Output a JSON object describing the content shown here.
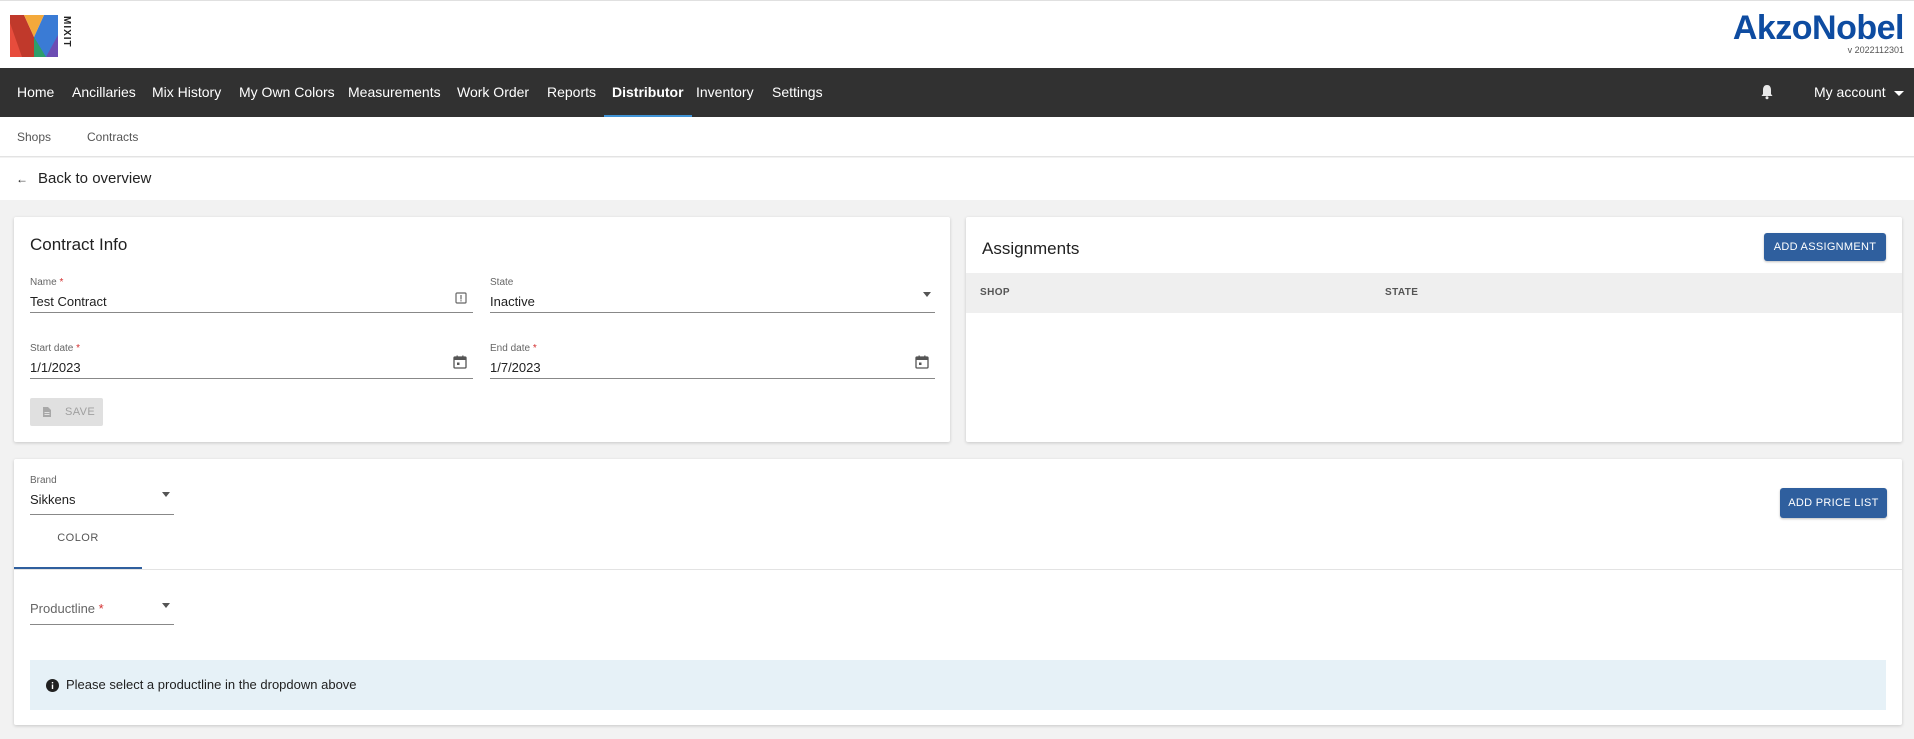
{
  "header": {
    "logo_text": "MIXIT",
    "brand": "AkzoNobel",
    "version": "v 2022112301"
  },
  "nav": {
    "items": [
      {
        "label": "Home"
      },
      {
        "label": "Ancillaries"
      },
      {
        "label": "Mix History"
      },
      {
        "label": "My Own Colors"
      },
      {
        "label": "Measurements"
      },
      {
        "label": "Work Order"
      },
      {
        "label": "Reports"
      },
      {
        "label": "Distributor",
        "active": true
      },
      {
        "label": "Inventory"
      },
      {
        "label": "Settings"
      }
    ],
    "account_label": "My account"
  },
  "subnav": {
    "items": [
      {
        "label": "Shops"
      },
      {
        "label": "Contracts"
      }
    ]
  },
  "back_label": "Back to overview",
  "contract_info": {
    "title": "Contract Info",
    "name_label": "Name",
    "name_value": "Test Contract",
    "state_label": "State",
    "state_value": "Inactive",
    "start_label": "Start date",
    "start_value": "1/1/2023",
    "end_label": "End date",
    "end_value": "1/7/2023",
    "save_label": "SAVE",
    "required_mark": "*"
  },
  "assignments": {
    "title": "Assignments",
    "add_label": "ADD ASSIGNMENT",
    "columns": [
      "SHOP",
      "STATE"
    ]
  },
  "pricing": {
    "brand_label": "Brand",
    "brand_value": "Sikkens",
    "add_price_list_label": "ADD PRICE LIST",
    "tabs": [
      {
        "label": "COLOR",
        "active": true
      }
    ],
    "productline_label": "Productline",
    "info_message": "Please select a productline in the dropdown above"
  },
  "colors": {
    "accent": "#2f5f9e",
    "nav_bg": "#313131",
    "brand_blue": "#0e4ca1",
    "required": "#d32f2f",
    "info_bg": "#e6f1f7"
  }
}
